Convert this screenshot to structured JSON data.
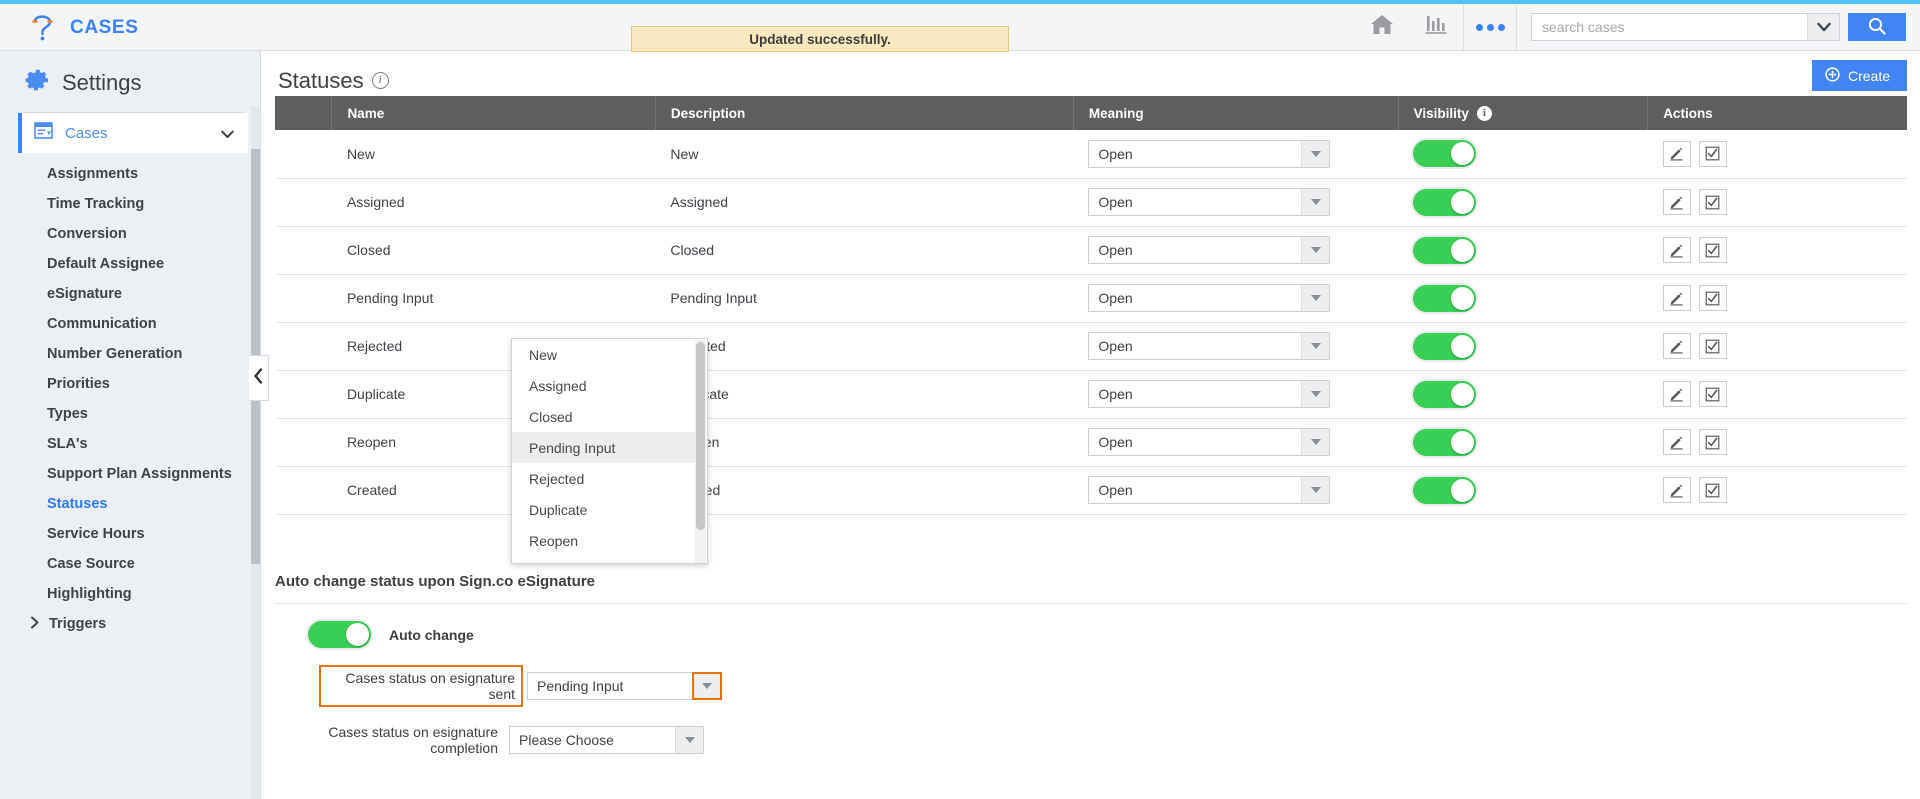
{
  "header": {
    "brand": "CASES",
    "brand_icon": "question-mark-logo-icon",
    "notification": "Updated successfully.",
    "home_icon": "home-icon",
    "reports_icon": "bar-chart-icon",
    "more_icon": "more-dots-icon",
    "search": {
      "placeholder": "search cases",
      "value": "",
      "caret_icon": "chevron-down-icon",
      "submit_icon": "search-icon"
    }
  },
  "sidebar": {
    "title": "Settings",
    "gear_icon": "gear-icon",
    "section": {
      "label": "Cases",
      "icon": "cases-icon",
      "chevron": "chevron-down-icon"
    },
    "items": [
      {
        "label": "Assignments",
        "active": false
      },
      {
        "label": "Time Tracking",
        "active": false
      },
      {
        "label": "Conversion",
        "active": false
      },
      {
        "label": "Default Assignee",
        "active": false
      },
      {
        "label": "eSignature",
        "active": false
      },
      {
        "label": "Communication",
        "active": false
      },
      {
        "label": "Number Generation",
        "active": false
      },
      {
        "label": "Priorities",
        "active": false
      },
      {
        "label": "Types",
        "active": false
      },
      {
        "label": "SLA's",
        "active": false
      },
      {
        "label": "Support Plan Assignments",
        "active": false
      },
      {
        "label": "Statuses",
        "active": true
      },
      {
        "label": "Service Hours",
        "active": false
      },
      {
        "label": "Case Source",
        "active": false
      },
      {
        "label": "Highlighting",
        "active": false
      }
    ],
    "triggers": {
      "label": "Triggers",
      "chevron": "chevron-right-icon"
    },
    "collapse_icon": "chevron-left-icon"
  },
  "main": {
    "page_title": "Statuses",
    "page_title_info": "i",
    "create_button": {
      "label": "Create",
      "icon": "plus-circle-icon"
    },
    "table": {
      "columns": [
        "",
        "Name",
        "Description",
        "Meaning",
        "Visibility",
        "Actions"
      ],
      "visibility_info": "i",
      "rows": [
        {
          "name": "New",
          "description": "New",
          "meaning": "Open",
          "visible": true
        },
        {
          "name": "Assigned",
          "description": "Assigned",
          "meaning": "Open",
          "visible": true
        },
        {
          "name": "Closed",
          "description": "Closed",
          "meaning": "Open",
          "visible": true
        },
        {
          "name": "Pending Input",
          "description": "Pending Input",
          "meaning": "Open",
          "visible": true
        },
        {
          "name": "Rejected",
          "description": "Rejected",
          "meaning": "Open",
          "visible": true
        },
        {
          "name": "Duplicate",
          "description": "Duplicate",
          "meaning": "Open",
          "visible": true
        },
        {
          "name": "Reopen",
          "description": "Reopen",
          "meaning": "Open",
          "visible": true
        },
        {
          "name": "Created",
          "description": "Created",
          "meaning": "Open",
          "visible": true
        }
      ],
      "row_actions": {
        "edit_icon": "pencil-icon",
        "check_icon": "checkbox-check-icon"
      },
      "select_arrow_icon": "triangle-down-icon"
    },
    "form": {
      "heading": "Auto change status upon Sign.co eSignature",
      "auto_change_label": "Auto change",
      "auto_change_on": true,
      "sent_label": "Cases status on esignature sent",
      "sent_value": "Pending Input",
      "completion_label": "Cases status on esignature completion",
      "completion_value": "Please Choose",
      "arrow_icon": "triangle-down-icon"
    }
  },
  "dropdown": {
    "options": [
      "New",
      "Assigned",
      "Closed",
      "Pending Input",
      "Rejected",
      "Duplicate",
      "Reopen"
    ],
    "selected": "Pending Input"
  },
  "colors": {
    "accent_blue": "#4184f3",
    "toggle_green": "#3ace55",
    "highlight_orange": "#e8720c",
    "notify_bg": "#f7e8bf",
    "table_head": "#5e5e5e"
  }
}
